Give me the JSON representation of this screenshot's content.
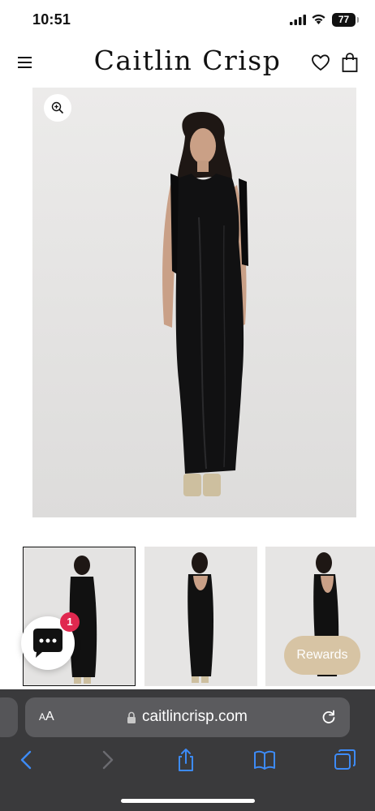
{
  "status_bar": {
    "time": "10:51",
    "battery": "77",
    "icons": [
      "signal-icon",
      "wifi-icon",
      "battery-icon"
    ]
  },
  "header": {
    "brand": "Caitlin Crisp",
    "icons": [
      "menu-icon",
      "heart-icon",
      "shopping-bag-icon"
    ]
  },
  "product": {
    "main_image_alt": "Model wearing black satin maxi dress, front view",
    "zoom_icon": "zoom-in-icon",
    "thumbnails": [
      {
        "view": "front",
        "selected": true
      },
      {
        "view": "back",
        "selected": false
      },
      {
        "view": "back-side",
        "selected": false
      }
    ]
  },
  "chat": {
    "icon": "chat-bubble-icon",
    "badge_count": "1"
  },
  "rewards": {
    "label": "Rewards"
  },
  "browser": {
    "text_size_label_small": "A",
    "text_size_label_large": "A",
    "url": "caitlincrisp.com",
    "icons": [
      "lock-icon",
      "reload-icon",
      "back-icon",
      "forward-icon",
      "share-icon",
      "bookmarks-icon",
      "tabs-icon"
    ]
  },
  "colors": {
    "accent_blue": "#3d8bf7",
    "rewards_bg": "#d7c4a4",
    "badge_red": "#e0284f",
    "browser_bg": "#3a3a3c"
  }
}
